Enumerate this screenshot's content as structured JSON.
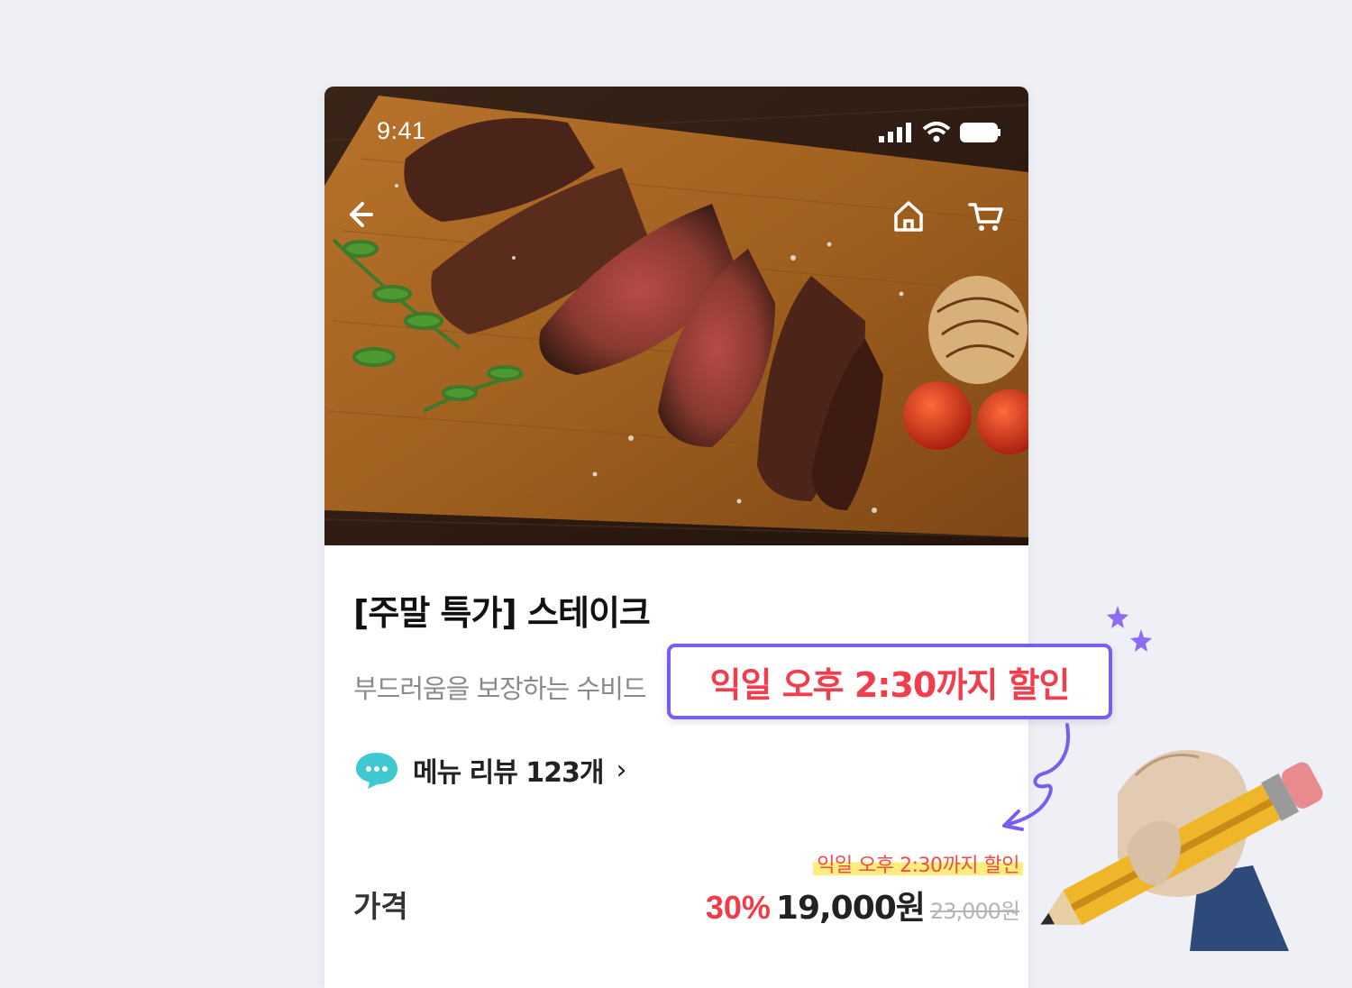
{
  "status_bar": {
    "time": "9:41"
  },
  "nav": {
    "back_icon": "arrow-left-icon",
    "home_icon": "home-icon",
    "cart_icon": "cart-icon"
  },
  "product": {
    "title": "[주말 특가] 스테이크",
    "description": "부드러움을 보장하는 수비드",
    "review_icon": "chat-bubble-icon",
    "review_label": "메뉴 리뷰 123개",
    "review_chevron": "›",
    "price_label": "가격",
    "discount_note": "익일 오후 2:30까지 할인",
    "discount_rate": "30%",
    "sale_price": "19,000원",
    "original_price": "23,000원"
  },
  "callout": {
    "text": "익일 오후 2:30까지 할인",
    "border_color": "#7b5cf0",
    "text_color": "#f23d4d"
  },
  "colors": {
    "accent_red": "#f03b48",
    "accent_purple": "#7b5cf0",
    "review_icon": "#3ec8d0"
  }
}
